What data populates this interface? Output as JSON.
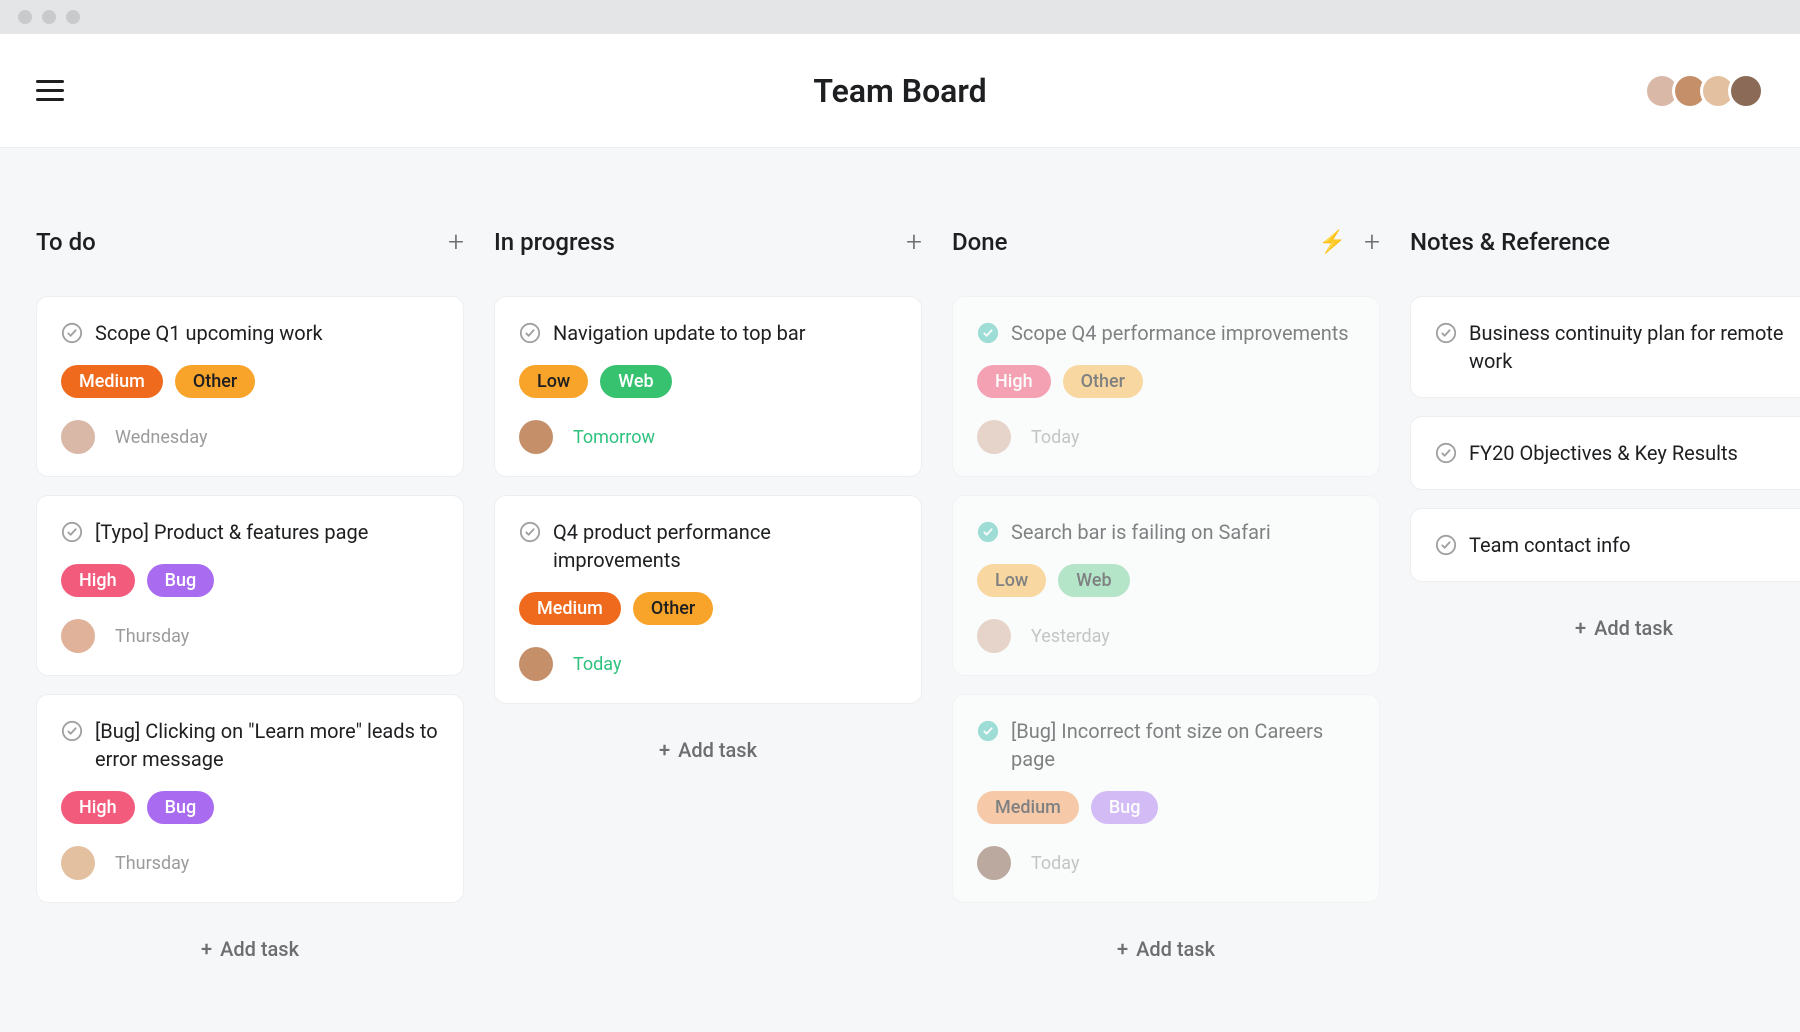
{
  "header": {
    "title": "Team Board"
  },
  "add_task_label": "Add task",
  "columns": [
    {
      "title": "To do",
      "show_bolt": false,
      "show_plus": true,
      "cards": [
        {
          "title": "Scope Q1 upcoming work",
          "done": false,
          "faded": false,
          "tags": [
            {
              "label": "Medium",
              "cls": "c-orange white"
            },
            {
              "label": "Other",
              "cls": "c-amber"
            }
          ],
          "avatar": "av-1",
          "due": "Wednesday",
          "due_cls": ""
        },
        {
          "title": "[Typo] Product & features page",
          "done": false,
          "faded": false,
          "tags": [
            {
              "label": "High",
              "cls": "c-pink white"
            },
            {
              "label": "Bug",
              "cls": "c-purple white"
            }
          ],
          "avatar": "av-5",
          "due": "Thursday",
          "due_cls": ""
        },
        {
          "title": "[Bug] Clicking on \"Learn more\" leads to error message",
          "done": false,
          "faded": false,
          "tags": [
            {
              "label": "High",
              "cls": "c-pink white"
            },
            {
              "label": "Bug",
              "cls": "c-purple white"
            }
          ],
          "avatar": "av-3",
          "due": "Thursday",
          "due_cls": ""
        }
      ]
    },
    {
      "title": "In progress",
      "show_bolt": false,
      "show_plus": true,
      "cards": [
        {
          "title": "Navigation update to top bar",
          "done": false,
          "faded": false,
          "tags": [
            {
              "label": "Low",
              "cls": "c-amber"
            },
            {
              "label": "Web",
              "cls": "c-green white"
            }
          ],
          "avatar": "av-2",
          "due": "Tomorrow",
          "due_cls": "green"
        },
        {
          "title": "Q4 product performance improvements",
          "done": false,
          "faded": false,
          "tags": [
            {
              "label": "Medium",
              "cls": "c-orange white"
            },
            {
              "label": "Other",
              "cls": "c-amber"
            }
          ],
          "avatar": "av-2",
          "due": "Today",
          "due_cls": "green"
        }
      ]
    },
    {
      "title": "Done",
      "show_bolt": true,
      "show_plus": true,
      "cards": [
        {
          "title": "Scope Q4 performance improvements",
          "done": true,
          "faded": true,
          "tags": [
            {
              "label": "High",
              "cls": "c-pink white"
            },
            {
              "label": "Other",
              "cls": "c-amber-lt"
            }
          ],
          "avatar": "av-1",
          "due": "Today",
          "due_cls": ""
        },
        {
          "title": "Search bar is failing on Safari",
          "done": true,
          "faded": true,
          "tags": [
            {
              "label": "Low",
              "cls": "c-amber-lt"
            },
            {
              "label": "Web",
              "cls": "c-green-lt"
            }
          ],
          "avatar": "av-1",
          "due": "Yesterday",
          "due_cls": ""
        },
        {
          "title": "[Bug] Incorrect font size on Careers page",
          "done": true,
          "faded": true,
          "tags": [
            {
              "label": "Medium",
              "cls": "c-orange-lt"
            },
            {
              "label": "Bug",
              "cls": "c-purple-lt white"
            }
          ],
          "avatar": "av-4",
          "due": "Today",
          "due_cls": ""
        }
      ]
    },
    {
      "title": "Notes & Reference",
      "show_bolt": false,
      "show_plus": false,
      "cards": [
        {
          "title": "Business continuity plan for remote work",
          "done": false,
          "faded": false,
          "tags": [],
          "avatar": null,
          "due": null
        },
        {
          "title": "FY20 Objectives & Key Results",
          "done": false,
          "faded": false,
          "tags": [],
          "avatar": null,
          "due": null
        },
        {
          "title": "Team contact info",
          "done": false,
          "faded": false,
          "tags": [],
          "avatar": null,
          "due": null
        }
      ]
    }
  ]
}
